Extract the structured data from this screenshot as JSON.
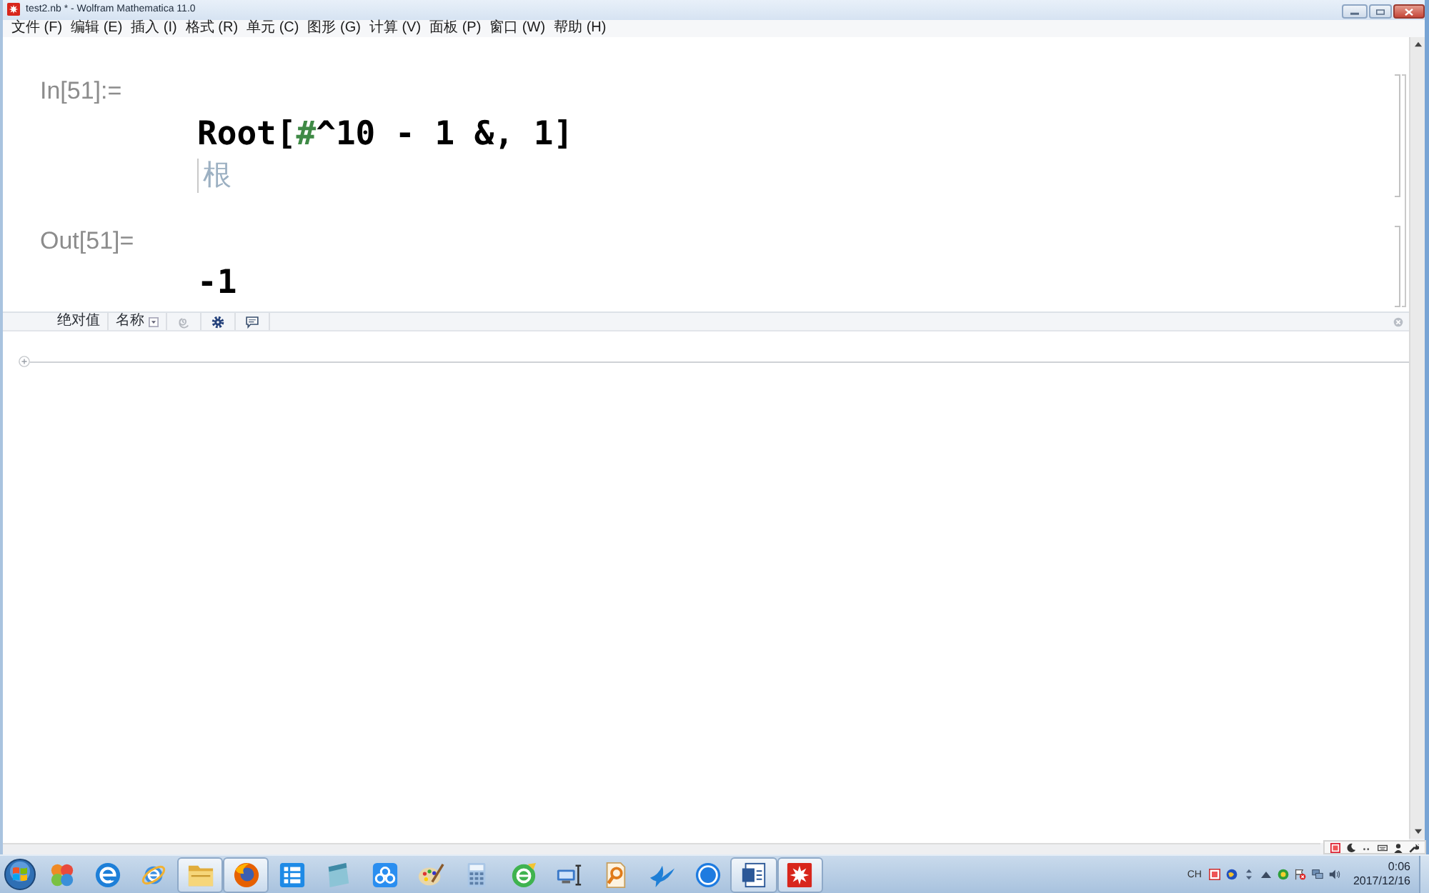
{
  "window": {
    "title": "test2.nb * - Wolfram Mathematica 11.0"
  },
  "menu": [
    "文件 (F)",
    "编辑 (E)",
    "插入 (I)",
    "格式 (R)",
    "单元 (C)",
    "图形 (G)",
    "计算 (V)",
    "面板 (P)",
    "窗口 (W)",
    "帮助 (H)"
  ],
  "notebook": {
    "cells": [
      {
        "kind": "input",
        "label": "In[51]:=",
        "tokens": [
          {
            "kind": "plain",
            "text": "Root["
          },
          {
            "kind": "slot",
            "text": "#"
          },
          {
            "kind": "plain",
            "text": "^10 - 1 &, 1]"
          }
        ],
        "hint": "根"
      },
      {
        "kind": "output",
        "label": "Out[51]=",
        "tokens": [
          {
            "kind": "plain",
            "text": "-1"
          }
        ]
      }
    ]
  },
  "toolbar": {
    "items": [
      {
        "kind": "text",
        "label": "绝对值"
      },
      {
        "kind": "dropdown",
        "label": "名称"
      }
    ]
  },
  "taskbar": {
    "buttons": [
      {
        "running": false
      },
      {
        "running": false
      },
      {
        "running": false
      },
      {
        "running": true
      },
      {
        "running": true
      },
      {
        "running": false
      },
      {
        "running": false
      },
      {
        "running": false
      },
      {
        "running": false
      },
      {
        "running": false
      },
      {
        "running": false
      },
      {
        "running": false
      },
      {
        "running": false
      },
      {
        "running": false
      },
      {
        "running": false
      },
      {
        "running": true
      },
      {
        "running": true
      }
    ],
    "language": "CH",
    "time": "0:06",
    "date": "2017/12/16"
  }
}
